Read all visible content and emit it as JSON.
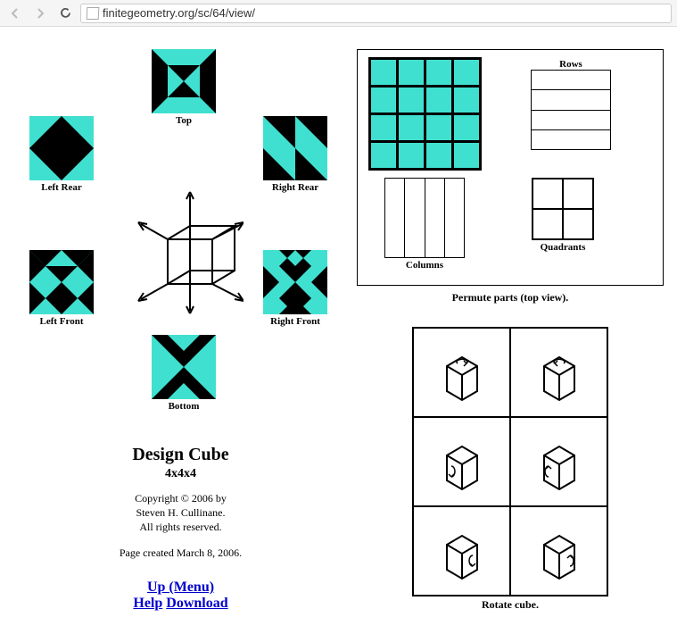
{
  "url": "finitegeometry.org/sc/64/view/",
  "faces": {
    "top": "Top",
    "left_rear": "Left Rear",
    "right_rear": "Right Rear",
    "left_front": "Left Front",
    "right_front": "Right Front",
    "bottom": "Bottom"
  },
  "title": "Design Cube",
  "subtitle": "4x4x4",
  "copyright_line1": "Copyright © 2006 by",
  "copyright_line2": "Steven H. Cullinane.",
  "copyright_line3": "All rights reserved.",
  "page_created": "Page created March 8, 2006.",
  "links": {
    "up": "Up (Menu)",
    "help": "Help",
    "download": "Download"
  },
  "permute": {
    "rows": "Rows",
    "columns": "Columns",
    "quadrants": "Quadrants",
    "caption": "Permute parts (top view)."
  },
  "rotate_caption": "Rotate cube."
}
